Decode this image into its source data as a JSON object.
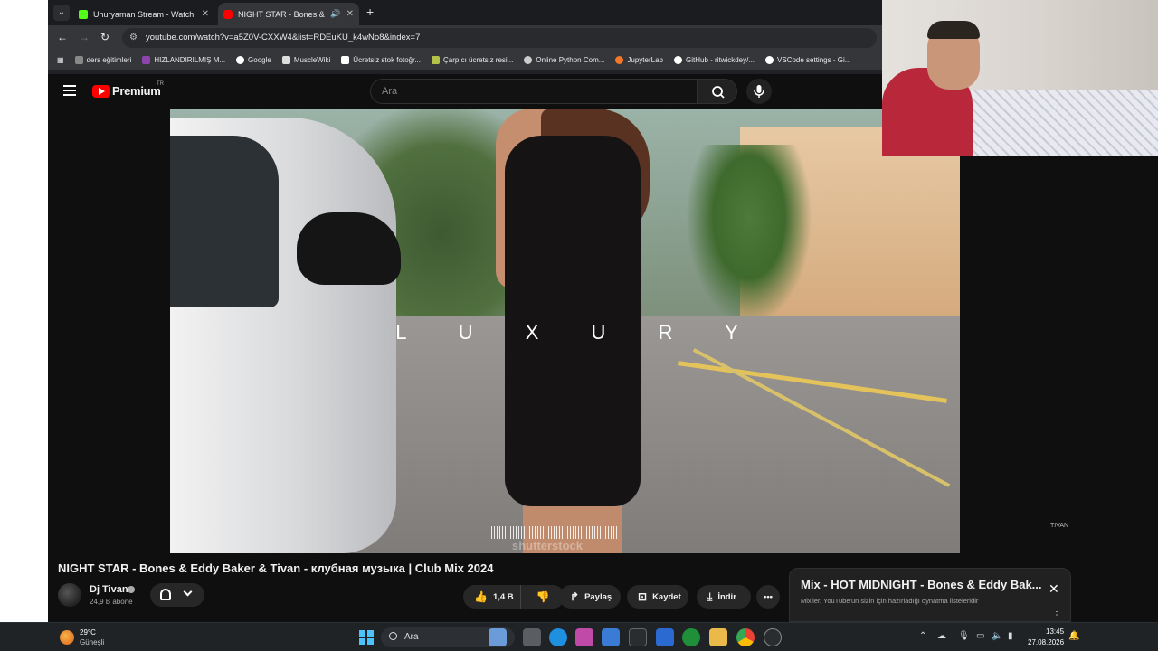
{
  "browser": {
    "tabs": [
      {
        "title": "Uhuryaman Stream - Watch Live",
        "active": false
      },
      {
        "title": "NIGHT STAR - Bones & Eddy Baker",
        "active": true
      }
    ],
    "new_tab": "+",
    "tab_close": "✕",
    "url": "youtube.com/watch?v=a5Z0V-CXXW4&list=RDEuKU_k4wNo8&index=7",
    "bookmarks": [
      "ders eğitimleri",
      "HIZLANDIRILMIŞ M...",
      "Google",
      "MuscleWiki",
      "Ücretsiz stok fotoğr...",
      "Çarpıcı ücretsiz resi...",
      "Online Python Com...",
      "JupyterLab",
      "GitHub - ritwickdey/...",
      "VSCode settings - Gi..."
    ]
  },
  "youtube": {
    "brand": "Premium",
    "region": "TR",
    "search_placeholder": "Ara"
  },
  "video": {
    "overlay_text": "L U X U R Y",
    "watermark": "shutterstock",
    "corner_logo": "TIVAN",
    "title": "NIGHT STAR - Bones & Eddy Baker & Tivan - клубная музыка | Club Mix 2024"
  },
  "channel": {
    "name": "Dj Tivan",
    "subscribers": "24,9 B abone"
  },
  "actions": {
    "likes": "1,4 B",
    "share": "Paylaş",
    "save": "Kaydet",
    "download": "İndir",
    "more": "•••"
  },
  "mix": {
    "title": "Mix - HOT MIDNIGHT - Bones & Eddy Bak...",
    "subtitle": "Mix'ler, YouTube'un sizin için hazırladığı oynatma listeleridir",
    "close": "✕",
    "more": "⋮"
  },
  "taskbar": {
    "temperature": "29°C",
    "weather": "Güneşli",
    "search": "Ara",
    "time": "13:45",
    "date": "27.08.2026"
  }
}
